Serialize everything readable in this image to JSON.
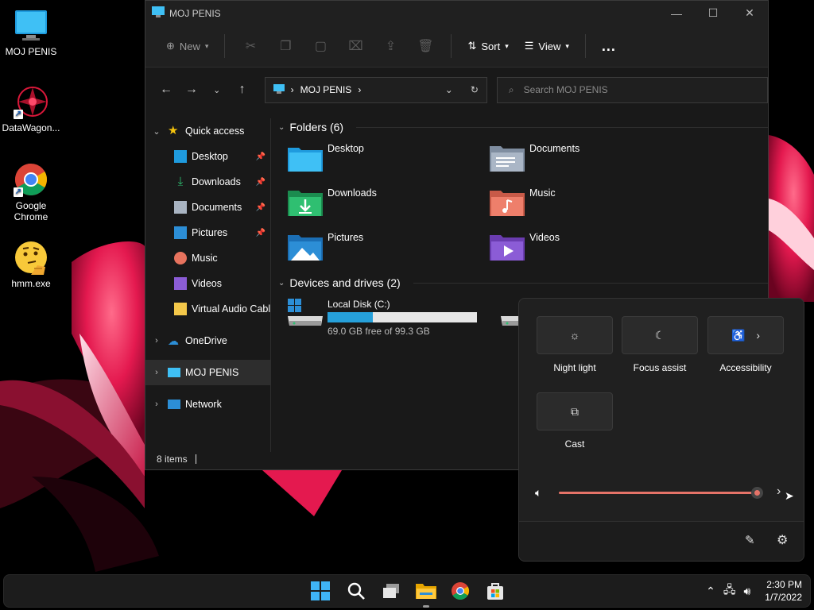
{
  "desktop": {
    "icons": [
      {
        "label": "MOJ PENIS"
      },
      {
        "label": "DataWagon..."
      },
      {
        "label": "Google Chrome"
      },
      {
        "label": "hmm.exe"
      }
    ]
  },
  "explorer": {
    "title": "MOJ PENIS",
    "toolbar": {
      "new_label": "New",
      "sort_label": "Sort",
      "view_label": "View",
      "more_label": "..."
    },
    "address": {
      "location": "MOJ PENIS"
    },
    "search": {
      "placeholder": "Search MOJ PENIS"
    },
    "nav": [
      {
        "label": "Quick access"
      },
      {
        "label": "Desktop"
      },
      {
        "label": "Downloads"
      },
      {
        "label": "Documents"
      },
      {
        "label": "Pictures"
      },
      {
        "label": "Music"
      },
      {
        "label": "Videos"
      },
      {
        "label": "Virtual Audio Cabl"
      },
      {
        "label": "OneDrive"
      },
      {
        "label": "MOJ PENIS"
      },
      {
        "label": "Network"
      }
    ],
    "folders_header": "Folders (6)",
    "folders": [
      {
        "label": "Desktop"
      },
      {
        "label": "Documents"
      },
      {
        "label": "Downloads"
      },
      {
        "label": "Music"
      },
      {
        "label": "Pictures"
      },
      {
        "label": "Videos"
      }
    ],
    "drives_header": "Devices and drives (2)",
    "drive": {
      "name": "Local Disk (C:)",
      "free_text": "69.0 GB free of 99.3 GB",
      "used_fraction": 0.305
    },
    "status": {
      "items": "8 items"
    }
  },
  "quick_settings": {
    "tiles": [
      {
        "label": "Night light"
      },
      {
        "label": "Focus assist"
      },
      {
        "label": "Accessibility"
      },
      {
        "label": "Cast"
      }
    ],
    "volume_fraction": 1.0,
    "colors": {
      "accent": "#e57368"
    }
  },
  "taskbar": {
    "time": "2:30 PM",
    "date": "1/7/2022"
  }
}
